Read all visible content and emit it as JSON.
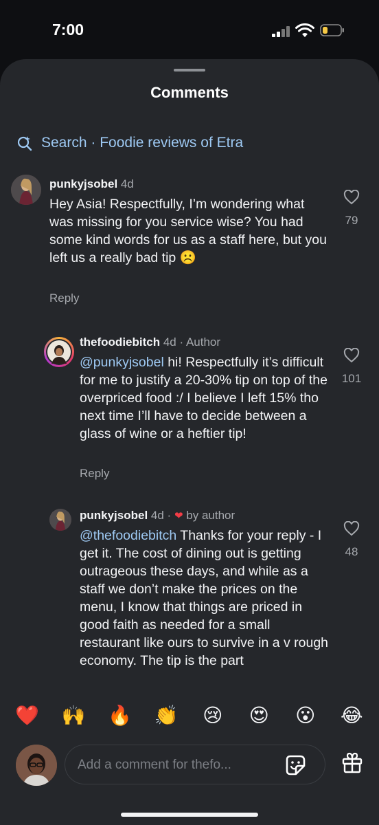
{
  "status_bar": {
    "time": "7:00"
  },
  "sheet": {
    "title": "Comments"
  },
  "search": {
    "label": "Search · Foodie reviews of Etra"
  },
  "comments": [
    {
      "username": "punkyjsobel",
      "age": "4d",
      "text": "Hey Asia! Respectfully, I’m wondering what was missing for you service wise? You had some kind words for us as a staff here, but you left us a really bad tip ☹️",
      "reply_label": "Reply",
      "likes": "79"
    },
    {
      "username": "thefoodiebitch",
      "age": "4d",
      "meta": "· Author",
      "mention": "@punkyjsobel",
      "text": " hi! Respectfully it’s difficult for me to justify a 20-30% tip on top of the overpriced food :/ I believe I left 15% tho next time I’ll have to decide between a glass of wine or a heftier tip!",
      "reply_label": "Reply",
      "likes": "101"
    },
    {
      "username": "punkyjsobel",
      "age": "4d ·",
      "meta": "by author",
      "mention": "@thefoodiebitch",
      "text": " Thanks for your reply - I get it. The cost of dining out is getting outrageous these days, and while as a staff we don’t make the prices on the menu, I know that things are priced in good faith as needed for a small restaurant like ours to survive in a v rough economy. The tip is the part",
      "likes": "48"
    }
  ],
  "reactions": [
    "❤️",
    "🙌",
    "🔥",
    "👏",
    "😢",
    "😍",
    "😮",
    "😂"
  ],
  "composer": {
    "placeholder": "Add a comment for thefo..."
  },
  "colors": {
    "background": "#25272b",
    "link": "#9ec9f3",
    "like_heart": "#f23c46"
  },
  "icons": {
    "search": "search-sparkle-icon",
    "like": "heart-outline-icon",
    "sticker": "sticker-icon",
    "gift": "gift-icon"
  }
}
